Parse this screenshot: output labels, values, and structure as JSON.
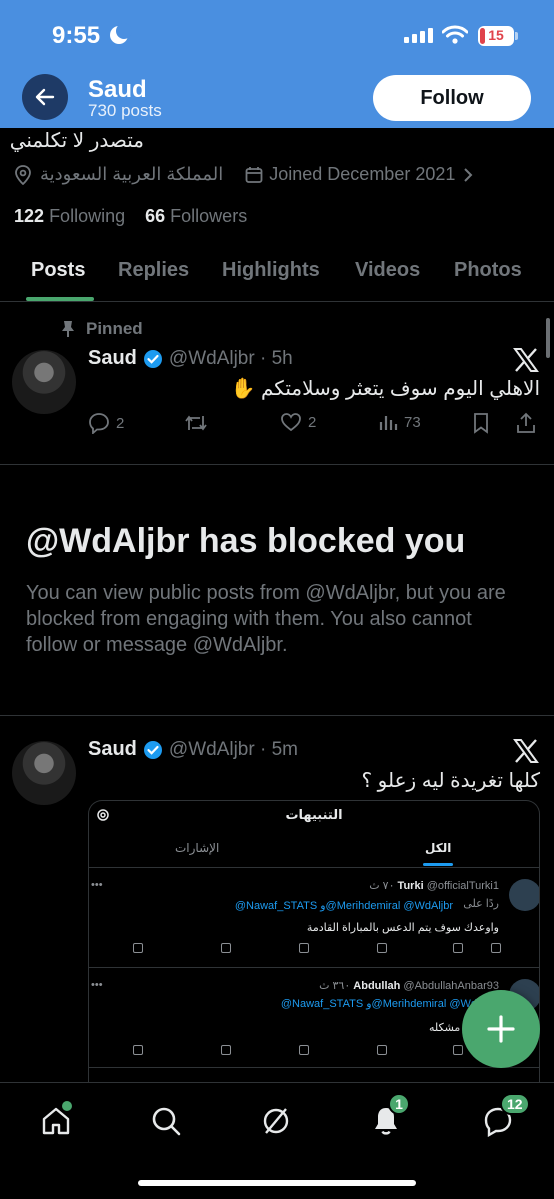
{
  "status_bar": {
    "time": "9:55",
    "battery": "15",
    "battery_level": 0.15
  },
  "header": {
    "name": "Saud",
    "posts": "730 posts",
    "follow_label": "Follow"
  },
  "profile": {
    "bio": "متصدر لا تكلمني",
    "location": "المملكة العربية السعودية",
    "joined": "Joined December 2021",
    "following_count": "122",
    "following_label": "Following",
    "followers_count": "66",
    "followers_label": "Followers"
  },
  "tabs": [
    "Posts",
    "Replies",
    "Highlights",
    "Videos",
    "Photos"
  ],
  "pinned_label": "Pinned",
  "tweets": [
    {
      "name": "Saud",
      "handle": "@WdAljbr · 5h",
      "text": "الاهلي اليوم سوف يتعثر وسلامتكم ✋",
      "replies": "2",
      "likes": "2",
      "views": "73"
    },
    {
      "name": "Saud",
      "handle": "@WdAljbr · 5m",
      "text": "كلها تغريدة ليه زعلو ؟"
    }
  ],
  "blocked": {
    "title": "@WdAljbr has blocked you",
    "desc": "You can view public posts from @WdAljbr, but you are blocked from engaging with them. You also cannot follow or message @WdAljbr."
  },
  "embed": {
    "title": "التنبيهات",
    "tab_all": "الكل",
    "tab_mentions": "الإشارات",
    "rows": [
      {
        "head_name": "Turki",
        "head_meta": "@officialTurki1 ٧٠ ث",
        "sub": "ردًا على",
        "mentions": "@Nawaf_STATS و@Merihdemiral @WdAljbr",
        "body": "واوعدك سوف يتم الدعس بالمباراة القادمة"
      },
      {
        "head_name": "Abdullah",
        "head_meta": "@AbdullahAnbar93 ٣٦٠ ث",
        "sub": "",
        "mentions": "@Nawaf_STATS و@Merihdemiral @WdAljbr",
        "body": "نصراوي مشكله"
      }
    ]
  },
  "nav": {
    "notifications_badge": "1",
    "messages_badge": "12"
  },
  "colors": {
    "banner": "#4a8fe0",
    "accent": "#4aa76e",
    "verified": "#1d9bf0"
  }
}
